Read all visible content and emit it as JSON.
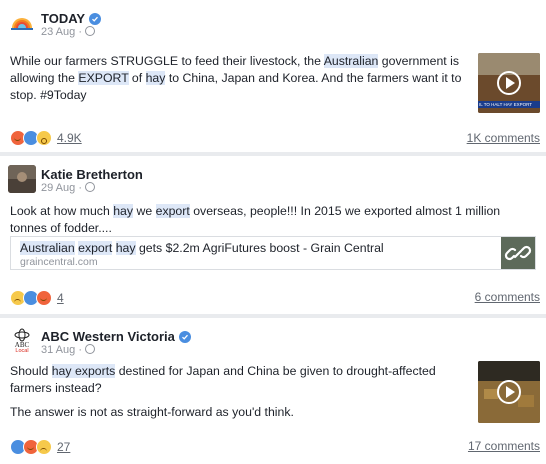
{
  "posts": [
    {
      "page_name": "TODAY",
      "verified": true,
      "date": "23 Aug",
      "text_parts": [
        "While our farmers STRUGGLE to feed their livestock, the ",
        "Australian",
        " government is allowing the ",
        "EXPORT",
        " of ",
        "hay",
        " to China, Japan and Korea. And the farmers want it to stop. #9Today"
      ],
      "video_caption": "IL TO HALT HAY EXPORT",
      "reaction_icons": [
        "angry-icon",
        "like-icon",
        "wow-icon"
      ],
      "reaction_count": "4.9K",
      "comments": "1K comments"
    },
    {
      "page_name": "Katie Bretherton",
      "verified": false,
      "date": "29 Aug",
      "text_parts": [
        "Look at how much ",
        "hay",
        " we ",
        "export",
        " overseas, people!!! In 2015 we exported almost 1 million tonnes of fodder...."
      ],
      "link_title_parts": [
        "Australian",
        " ",
        "export",
        " ",
        "hay",
        " gets $2.2m AgriFutures boost - Grain Central"
      ],
      "link_domain": "graincentral.com",
      "reaction_icons": [
        "sad-icon",
        "like-icon",
        "angry-icon"
      ],
      "reaction_count": "4",
      "comments": "6 comments"
    },
    {
      "page_name": "ABC Western Victoria",
      "verified": true,
      "logo_text": [
        "ABC",
        "Local"
      ],
      "date": "31 Aug",
      "text_parts": [
        "Should ",
        "hay exports",
        " destined for Japan and China be given to drought-affected farmers instead?"
      ],
      "text2": "The answer is not as straight-forward as you'd think.",
      "reaction_icons": [
        "like-icon",
        "angry-icon",
        "sad-icon"
      ],
      "reaction_count": "27",
      "comments": "17 comments"
    }
  ],
  "colors": {
    "accent": "#4a8ee0",
    "highlight": "#dde7f7",
    "meta": "#90949c",
    "angry": "#f0643c",
    "yellow": "#f6c94b"
  }
}
